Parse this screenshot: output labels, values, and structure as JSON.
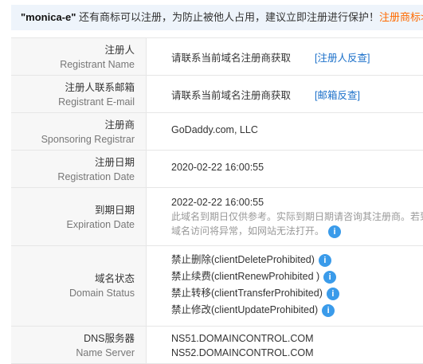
{
  "notice": {
    "brand": "\"monica-e\"",
    "message": " 还有商标可以注册，为防止被他人占用，建议立即注册进行保护！",
    "link": "注册商标>>"
  },
  "rows": {
    "registrant": {
      "zh": "注册人",
      "en": "Registrant Name",
      "value": "请联系当前域名注册商获取",
      "link": "[注册人反查]"
    },
    "email": {
      "zh": "注册人联系邮箱",
      "en": "Registrant E-mail",
      "value": "请联系当前域名注册商获取",
      "link": "[邮箱反查]"
    },
    "registrar": {
      "zh": "注册商",
      "en": "Sponsoring Registrar",
      "value": "GoDaddy.com, LLC"
    },
    "regdate": {
      "zh": "注册日期",
      "en": "Registration Date",
      "value": "2020-02-22 16:00:55"
    },
    "expdate": {
      "zh": "到期日期",
      "en": "Expiration Date",
      "value": "2022-02-22 16:00:55",
      "note1": "此域名到期日仅供参考。实际到期日期请咨询其注册商。若到",
      "note2": "域名访问将异常，如网站无法打开。"
    },
    "status": {
      "zh": "域名状态",
      "en": "Domain Status",
      "items": [
        "禁止删除(clientDeleteProhibited)",
        "禁止续费(clientRenewProhibited )",
        "禁止转移(clientTransferProhibited)",
        "禁止修改(clientUpdateProhibited)"
      ]
    },
    "dns": {
      "zh": "DNS服务器",
      "en": "Name Server",
      "ns1": "NS51.DOMAINCONTROL.COM",
      "ns2": "NS52.DOMAINCONTROL.COM"
    }
  },
  "info_glyph": "i"
}
